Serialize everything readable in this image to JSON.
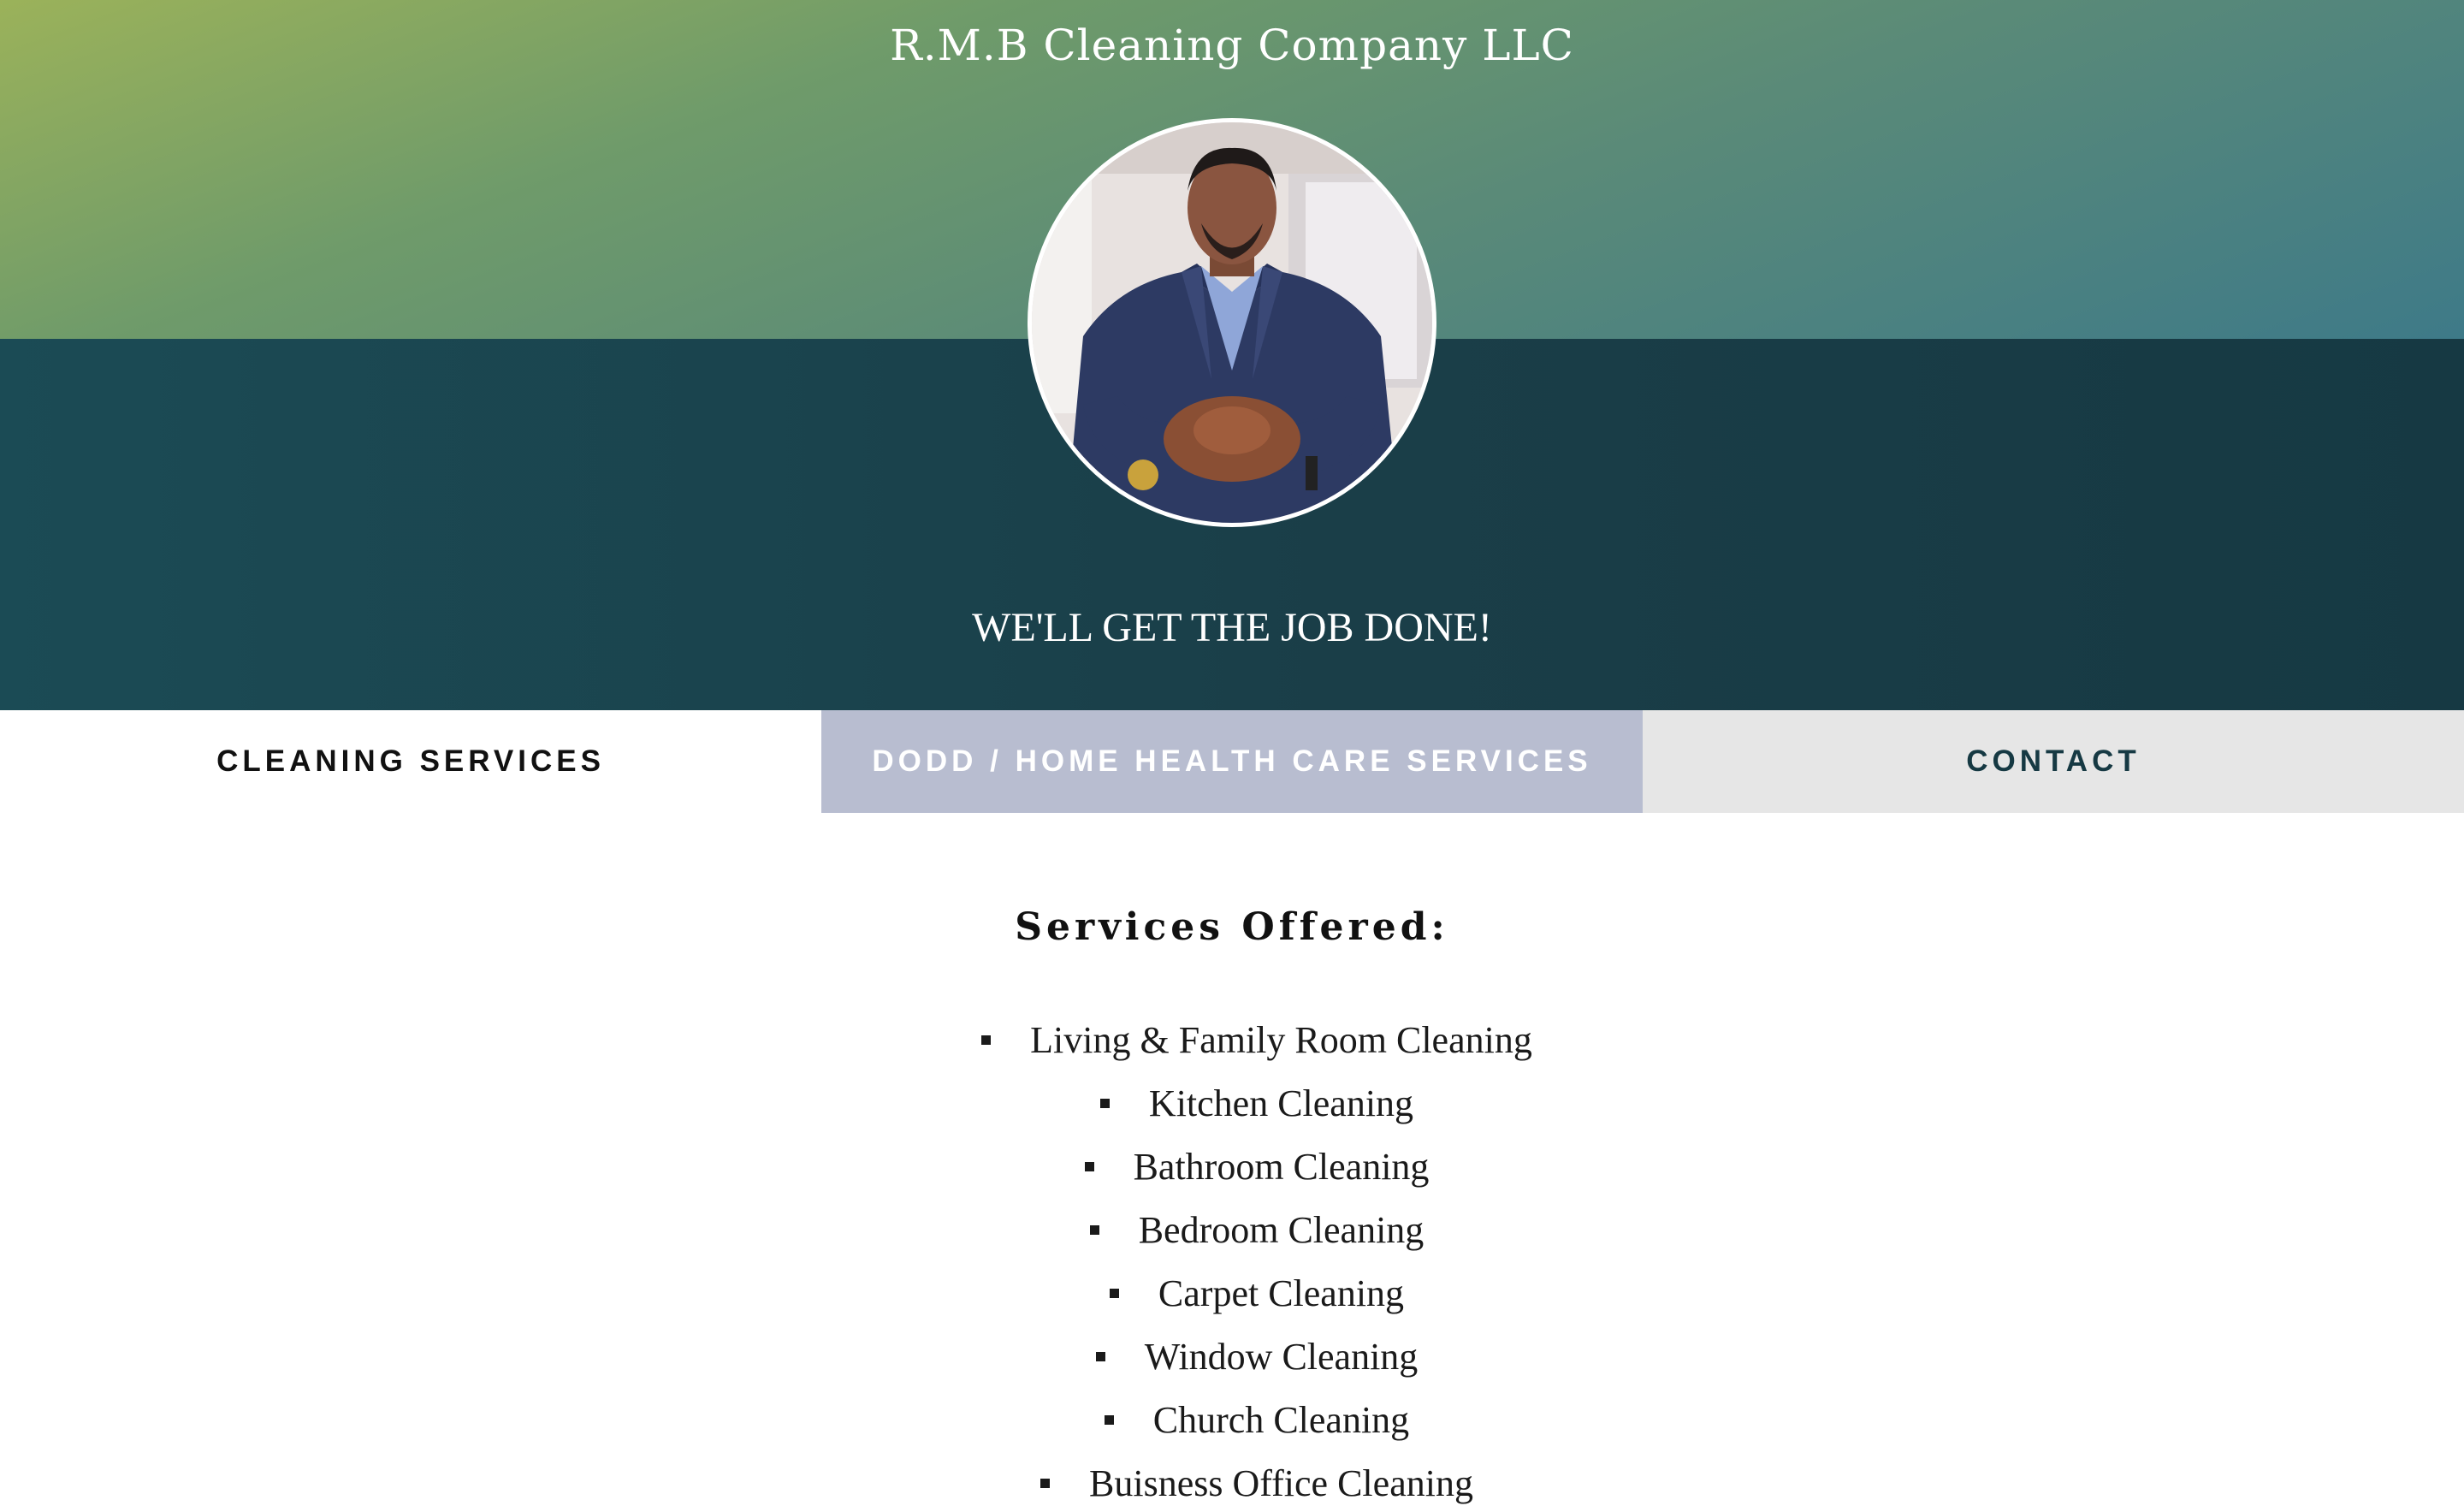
{
  "header": {
    "site_title": "R.M.B Cleaning Company LLC",
    "tagline": "WE'LL GET THE JOB DONE!",
    "colors": {
      "gradient_top_left": "#9bb25a",
      "gradient_top_right": "#3e7a88",
      "band_dark": "#1a3e48"
    }
  },
  "nav": {
    "tabs": [
      {
        "label": "CLEANING SERVICES",
        "active": true
      },
      {
        "label": "DODD / HOME HEALTH CARE SERVICES",
        "active": false
      },
      {
        "label": "CONTACT",
        "active": false
      }
    ]
  },
  "main": {
    "section_title": "Services Offered:",
    "services": [
      "Living & Family Room Cleaning",
      "Kitchen Cleaning",
      "Bathroom Cleaning",
      "Bedroom Cleaning",
      "Carpet Cleaning",
      "Window Cleaning",
      "Church Cleaning",
      "Buisness Office Cleaning"
    ]
  }
}
